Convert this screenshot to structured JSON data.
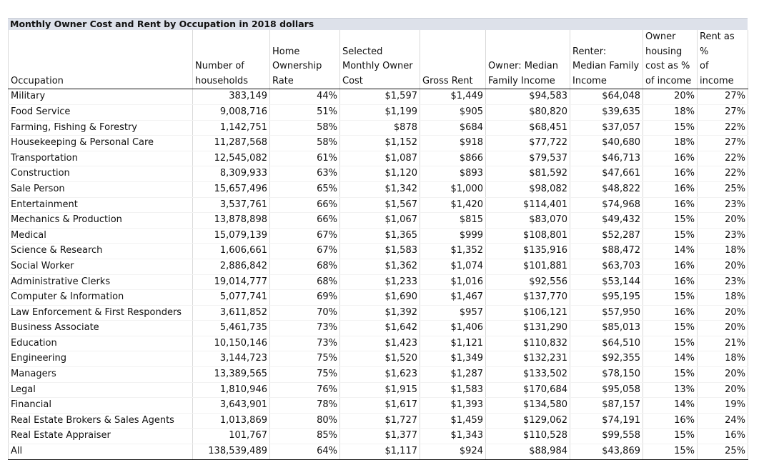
{
  "title": "Monthly Owner Cost and Rent by Occupation in 2018 dollars",
  "headers": [
    "Occupation",
    "Number of households",
    "Home Ownership Rate",
    "Selected Monthly Owner Cost",
    "Gross Rent",
    "Owner: Median Family Income",
    "Renter: Median Family Income",
    "Owner housing cost as % of income",
    "Rent as % of income"
  ],
  "header_lines": [
    [
      "Occupation"
    ],
    [
      "Number of",
      "households"
    ],
    [
      "Home",
      "Ownership",
      "Rate"
    ],
    [
      "Selected",
      "Monthly Owner",
      "Cost"
    ],
    [
      "Gross Rent"
    ],
    [
      "Owner: Median",
      "Family Income"
    ],
    [
      "Renter:",
      "Median Family",
      "Income"
    ],
    [
      "Owner",
      "housing",
      "cost as %",
      "of income"
    ],
    [
      "Rent as %",
      "of income"
    ]
  ],
  "rows": [
    [
      "Military",
      "383,149",
      "44%",
      "$1,597",
      "$1,449",
      "$94,583",
      "$64,048",
      "20%",
      "27%"
    ],
    [
      "Food Service",
      "9,008,716",
      "51%",
      "$1,199",
      "$905",
      "$80,820",
      "$39,635",
      "18%",
      "27%"
    ],
    [
      "Farming, Fishing & Forestry",
      "1,142,751",
      "58%",
      "$878",
      "$684",
      "$68,451",
      "$37,057",
      "15%",
      "22%"
    ],
    [
      "Housekeeping & Personal Care",
      "11,287,568",
      "58%",
      "$1,152",
      "$918",
      "$77,722",
      "$40,680",
      "18%",
      "27%"
    ],
    [
      "Transportation",
      "12,545,082",
      "61%",
      "$1,087",
      "$866",
      "$79,537",
      "$46,713",
      "16%",
      "22%"
    ],
    [
      "Construction",
      "8,309,933",
      "63%",
      "$1,120",
      "$893",
      "$81,592",
      "$47,661",
      "16%",
      "22%"
    ],
    [
      "Sale Person",
      "15,657,496",
      "65%",
      "$1,342",
      "$1,000",
      "$98,082",
      "$48,822",
      "16%",
      "25%"
    ],
    [
      "Entertainment",
      "3,537,761",
      "66%",
      "$1,567",
      "$1,420",
      "$114,401",
      "$74,968",
      "16%",
      "23%"
    ],
    [
      "Mechanics & Production",
      "13,878,898",
      "66%",
      "$1,067",
      "$815",
      "$83,070",
      "$49,432",
      "15%",
      "20%"
    ],
    [
      "Medical",
      "15,079,139",
      "67%",
      "$1,365",
      "$999",
      "$108,801",
      "$52,287",
      "15%",
      "23%"
    ],
    [
      "Science & Research",
      "1,606,661",
      "67%",
      "$1,583",
      "$1,352",
      "$135,916",
      "$88,472",
      "14%",
      "18%"
    ],
    [
      "Social Worker",
      "2,886,842",
      "68%",
      "$1,362",
      "$1,074",
      "$101,881",
      "$63,703",
      "16%",
      "20%"
    ],
    [
      "Administrative Clerks",
      "19,014,777",
      "68%",
      "$1,233",
      "$1,016",
      "$92,556",
      "$53,144",
      "16%",
      "23%"
    ],
    [
      "Computer & Information",
      "5,077,741",
      "69%",
      "$1,690",
      "$1,467",
      "$137,770",
      "$95,195",
      "15%",
      "18%"
    ],
    [
      "Law Enforcement & First Responders",
      "3,611,852",
      "70%",
      "$1,392",
      "$957",
      "$106,121",
      "$57,950",
      "16%",
      "20%"
    ],
    [
      "Business Associate",
      "5,461,735",
      "73%",
      "$1,642",
      "$1,406",
      "$131,290",
      "$85,013",
      "15%",
      "20%"
    ],
    [
      "Education",
      "10,150,146",
      "73%",
      "$1,423",
      "$1,121",
      "$110,832",
      "$64,510",
      "15%",
      "21%"
    ],
    [
      "Engineering",
      "3,144,723",
      "75%",
      "$1,520",
      "$1,349",
      "$132,231",
      "$92,355",
      "14%",
      "18%"
    ],
    [
      "Managers",
      "13,389,565",
      "75%",
      "$1,623",
      "$1,287",
      "$133,502",
      "$78,150",
      "15%",
      "20%"
    ],
    [
      "Legal",
      "1,810,946",
      "76%",
      "$1,915",
      "$1,583",
      "$170,684",
      "$95,058",
      "13%",
      "20%"
    ],
    [
      "Financial",
      "3,643,901",
      "78%",
      "$1,617",
      "$1,393",
      "$134,580",
      "$87,157",
      "14%",
      "19%"
    ],
    [
      "Real Estate Brokers & Sales Agents",
      "1,013,869",
      "80%",
      "$1,727",
      "$1,459",
      "$129,062",
      "$74,191",
      "16%",
      "24%"
    ],
    [
      "Real Estate Appraiser",
      "101,767",
      "85%",
      "$1,377",
      "$1,343",
      "$110,528",
      "$99,558",
      "15%",
      "16%"
    ],
    [
      "All",
      "138,539,489",
      "64%",
      "$1,117",
      "$924",
      "$88,984",
      "$43,869",
      "15%",
      "25%"
    ]
  ]
}
